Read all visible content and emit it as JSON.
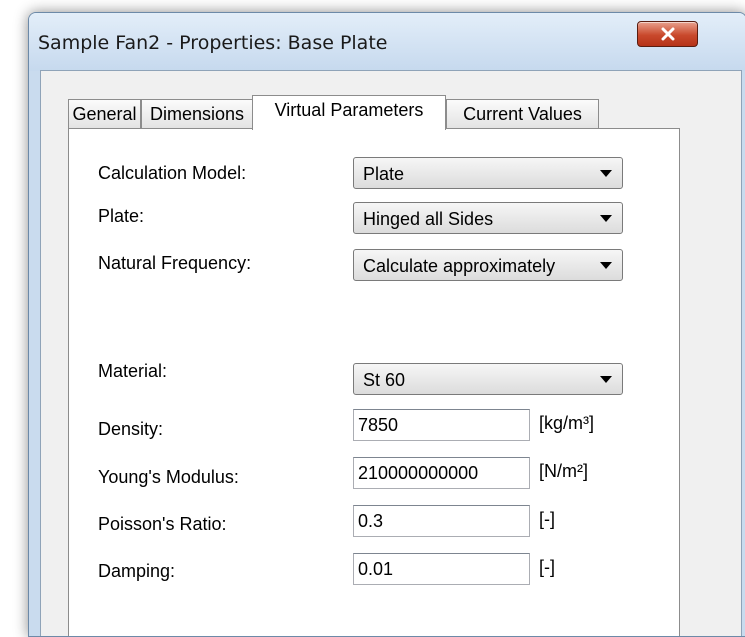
{
  "window": {
    "title": "Sample Fan2 - Properties: Base Plate"
  },
  "colors": {
    "titlebar": "#c6d9ee",
    "close_button": "#c9492c",
    "panel_background": "#ffffff",
    "dialog_background": "#f0f0f0"
  },
  "tabs": [
    {
      "label": "General",
      "active": false
    },
    {
      "label": "Dimensions",
      "active": false
    },
    {
      "label": "Virtual Parameters",
      "active": true
    },
    {
      "label": "Current Values",
      "active": false
    }
  ],
  "form": {
    "calculation_model": {
      "label": "Calculation Model:",
      "value": "Plate"
    },
    "plate": {
      "label": "Plate:",
      "value": "Hinged all Sides"
    },
    "natural_frequency": {
      "label": "Natural Frequency:",
      "value": "Calculate approximately"
    },
    "material": {
      "label": "Material:",
      "value": "St 60"
    },
    "density": {
      "label": "Density:",
      "value": "7850",
      "unit": "[kg/m³]"
    },
    "youngs_modulus": {
      "label": "Young's Modulus:",
      "value": "210000000000",
      "unit": "[N/m²]"
    },
    "poissons_ratio": {
      "label": "Poisson's Ratio:",
      "value": "0.3",
      "unit": "[-]"
    },
    "damping": {
      "label": "Damping:",
      "value": "0.01",
      "unit": "[-]"
    }
  },
  "icons": {
    "close": "close-icon",
    "dropdown": "chevron-down-icon"
  }
}
